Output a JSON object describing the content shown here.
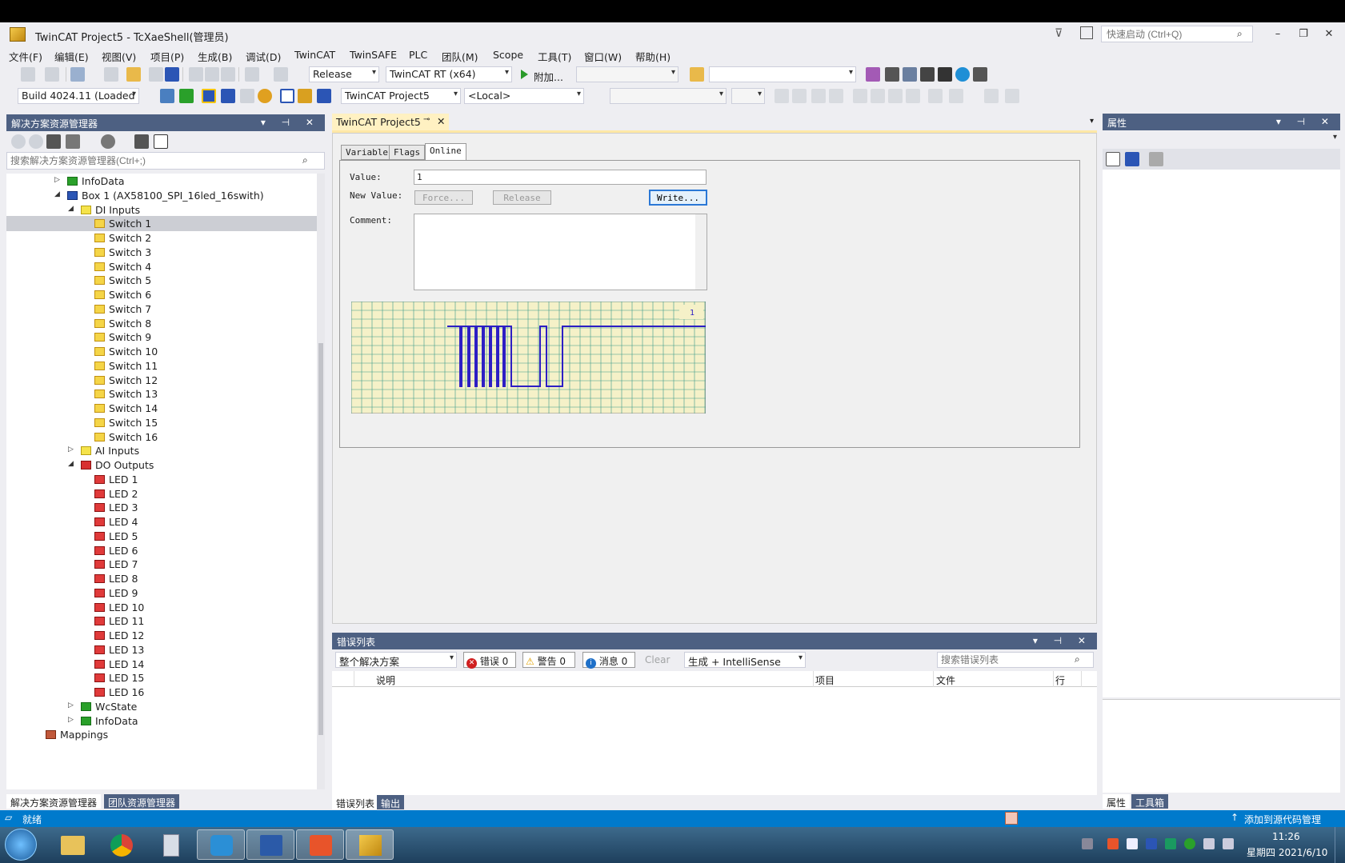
{
  "window": {
    "title": "TwinCAT Project5 - TcXaeShell(管理员)",
    "quick_launch_placeholder": "快速启动 (Ctrl+Q)"
  },
  "menu": [
    "文件(F)",
    "编辑(E)",
    "视图(V)",
    "项目(P)",
    "生成(B)",
    "调试(D)",
    "TwinCAT",
    "TwinSAFE",
    "PLC",
    "团队(M)",
    "Scope",
    "工具(T)",
    "窗口(W)",
    "帮助(H)"
  ],
  "toolbar1": {
    "config": "Release",
    "platform": "TwinCAT RT (x64)",
    "attach": "附加..."
  },
  "toolbar2": {
    "build": "Build 4024.11 (Loaded",
    "project": "TwinCAT Project5",
    "target": "<Local>"
  },
  "solution_explorer": {
    "title": "解决方案资源管理器",
    "search_placeholder": "搜索解决方案资源管理器(Ctrl+;)",
    "items": [
      {
        "label": "InfoData",
        "icon": "device-icon",
        "expander": "collapsed"
      },
      {
        "label": "Box 1 (AX58100_SPI_16led_16swith)",
        "icon": "box-icon",
        "expander": "expanded"
      },
      {
        "label": "DI Inputs",
        "icon": "folder-icon",
        "expander": "expanded"
      },
      {
        "label": "Switch 1",
        "icon": "input-icon",
        "selected": true
      },
      {
        "label": "Switch 2",
        "icon": "input-icon"
      },
      {
        "label": "Switch 3",
        "icon": "input-icon"
      },
      {
        "label": "Switch 4",
        "icon": "input-icon"
      },
      {
        "label": "Switch 5",
        "icon": "input-icon"
      },
      {
        "label": "Switch 6",
        "icon": "input-icon"
      },
      {
        "label": "Switch 7",
        "icon": "input-icon"
      },
      {
        "label": "Switch 8",
        "icon": "input-icon"
      },
      {
        "label": "Switch 9",
        "icon": "input-icon"
      },
      {
        "label": "Switch 10",
        "icon": "input-icon"
      },
      {
        "label": "Switch 11",
        "icon": "input-icon"
      },
      {
        "label": "Switch 12",
        "icon": "input-icon"
      },
      {
        "label": "Switch 13",
        "icon": "input-icon"
      },
      {
        "label": "Switch 14",
        "icon": "input-icon"
      },
      {
        "label": "Switch 15",
        "icon": "input-icon"
      },
      {
        "label": "Switch 16",
        "icon": "input-icon"
      },
      {
        "label": "AI Inputs",
        "icon": "folder-icon",
        "expander": "collapsed"
      },
      {
        "label": "DO Outputs",
        "icon": "output-folder-icon",
        "expander": "expanded"
      },
      {
        "label": "LED 1",
        "icon": "output-icon"
      },
      {
        "label": "LED 2",
        "icon": "output-icon"
      },
      {
        "label": "LED 3",
        "icon": "output-icon"
      },
      {
        "label": "LED 4",
        "icon": "output-icon"
      },
      {
        "label": "LED 5",
        "icon": "output-icon"
      },
      {
        "label": "LED 6",
        "icon": "output-icon"
      },
      {
        "label": "LED 7",
        "icon": "output-icon"
      },
      {
        "label": "LED 8",
        "icon": "output-icon"
      },
      {
        "label": "LED 9",
        "icon": "output-icon"
      },
      {
        "label": "LED 10",
        "icon": "output-icon"
      },
      {
        "label": "LED 11",
        "icon": "output-icon"
      },
      {
        "label": "LED 12",
        "icon": "output-icon"
      },
      {
        "label": "LED 13",
        "icon": "output-icon"
      },
      {
        "label": "LED 14",
        "icon": "output-icon"
      },
      {
        "label": "LED 15",
        "icon": "output-icon"
      },
      {
        "label": "LED 16",
        "icon": "output-icon"
      },
      {
        "label": "WcState",
        "icon": "device-icon",
        "expander": "collapsed"
      },
      {
        "label": "InfoData",
        "icon": "device-icon",
        "expander": "collapsed"
      },
      {
        "label": "Mappings",
        "icon": "mappings-icon"
      }
    ],
    "bottom_tabs": [
      "解决方案资源管理器",
      "团队资源管理器"
    ]
  },
  "editor": {
    "doc_tab": "TwinCAT Project5",
    "tabs": [
      "Variable",
      "Flags",
      "Online"
    ],
    "value_label": "Value:",
    "value": "1",
    "new_value_label": "New Value:",
    "force_btn": "Force...",
    "release_btn": "Release",
    "write_btn": "Write...",
    "comment_label": "Comment:",
    "plot_value": "1"
  },
  "error_list": {
    "title": "错误列表",
    "scope": "整个解决方案",
    "errors": "错误 0",
    "warnings": "警告 0",
    "messages": "消息 0",
    "clear": "Clear",
    "filter": "生成 + IntelliSense",
    "search_placeholder": "搜索错误列表",
    "columns": [
      "说明",
      "项目",
      "文件",
      "行"
    ],
    "bottom_tabs": [
      "错误列表",
      "输出"
    ]
  },
  "properties": {
    "title": "属性",
    "bottom_tabs": [
      "属性",
      "工具箱"
    ]
  },
  "status": {
    "text": "就绪",
    "source_control": "添加到源代码管理"
  },
  "taskbar": {
    "time": "11:26",
    "date": "星期四 2021/6/10"
  },
  "colors": {
    "accent": "#007acc",
    "inactive_header": "#4d6082",
    "doc_tab": "#fff1c2",
    "signal": "#2d1fc4"
  }
}
